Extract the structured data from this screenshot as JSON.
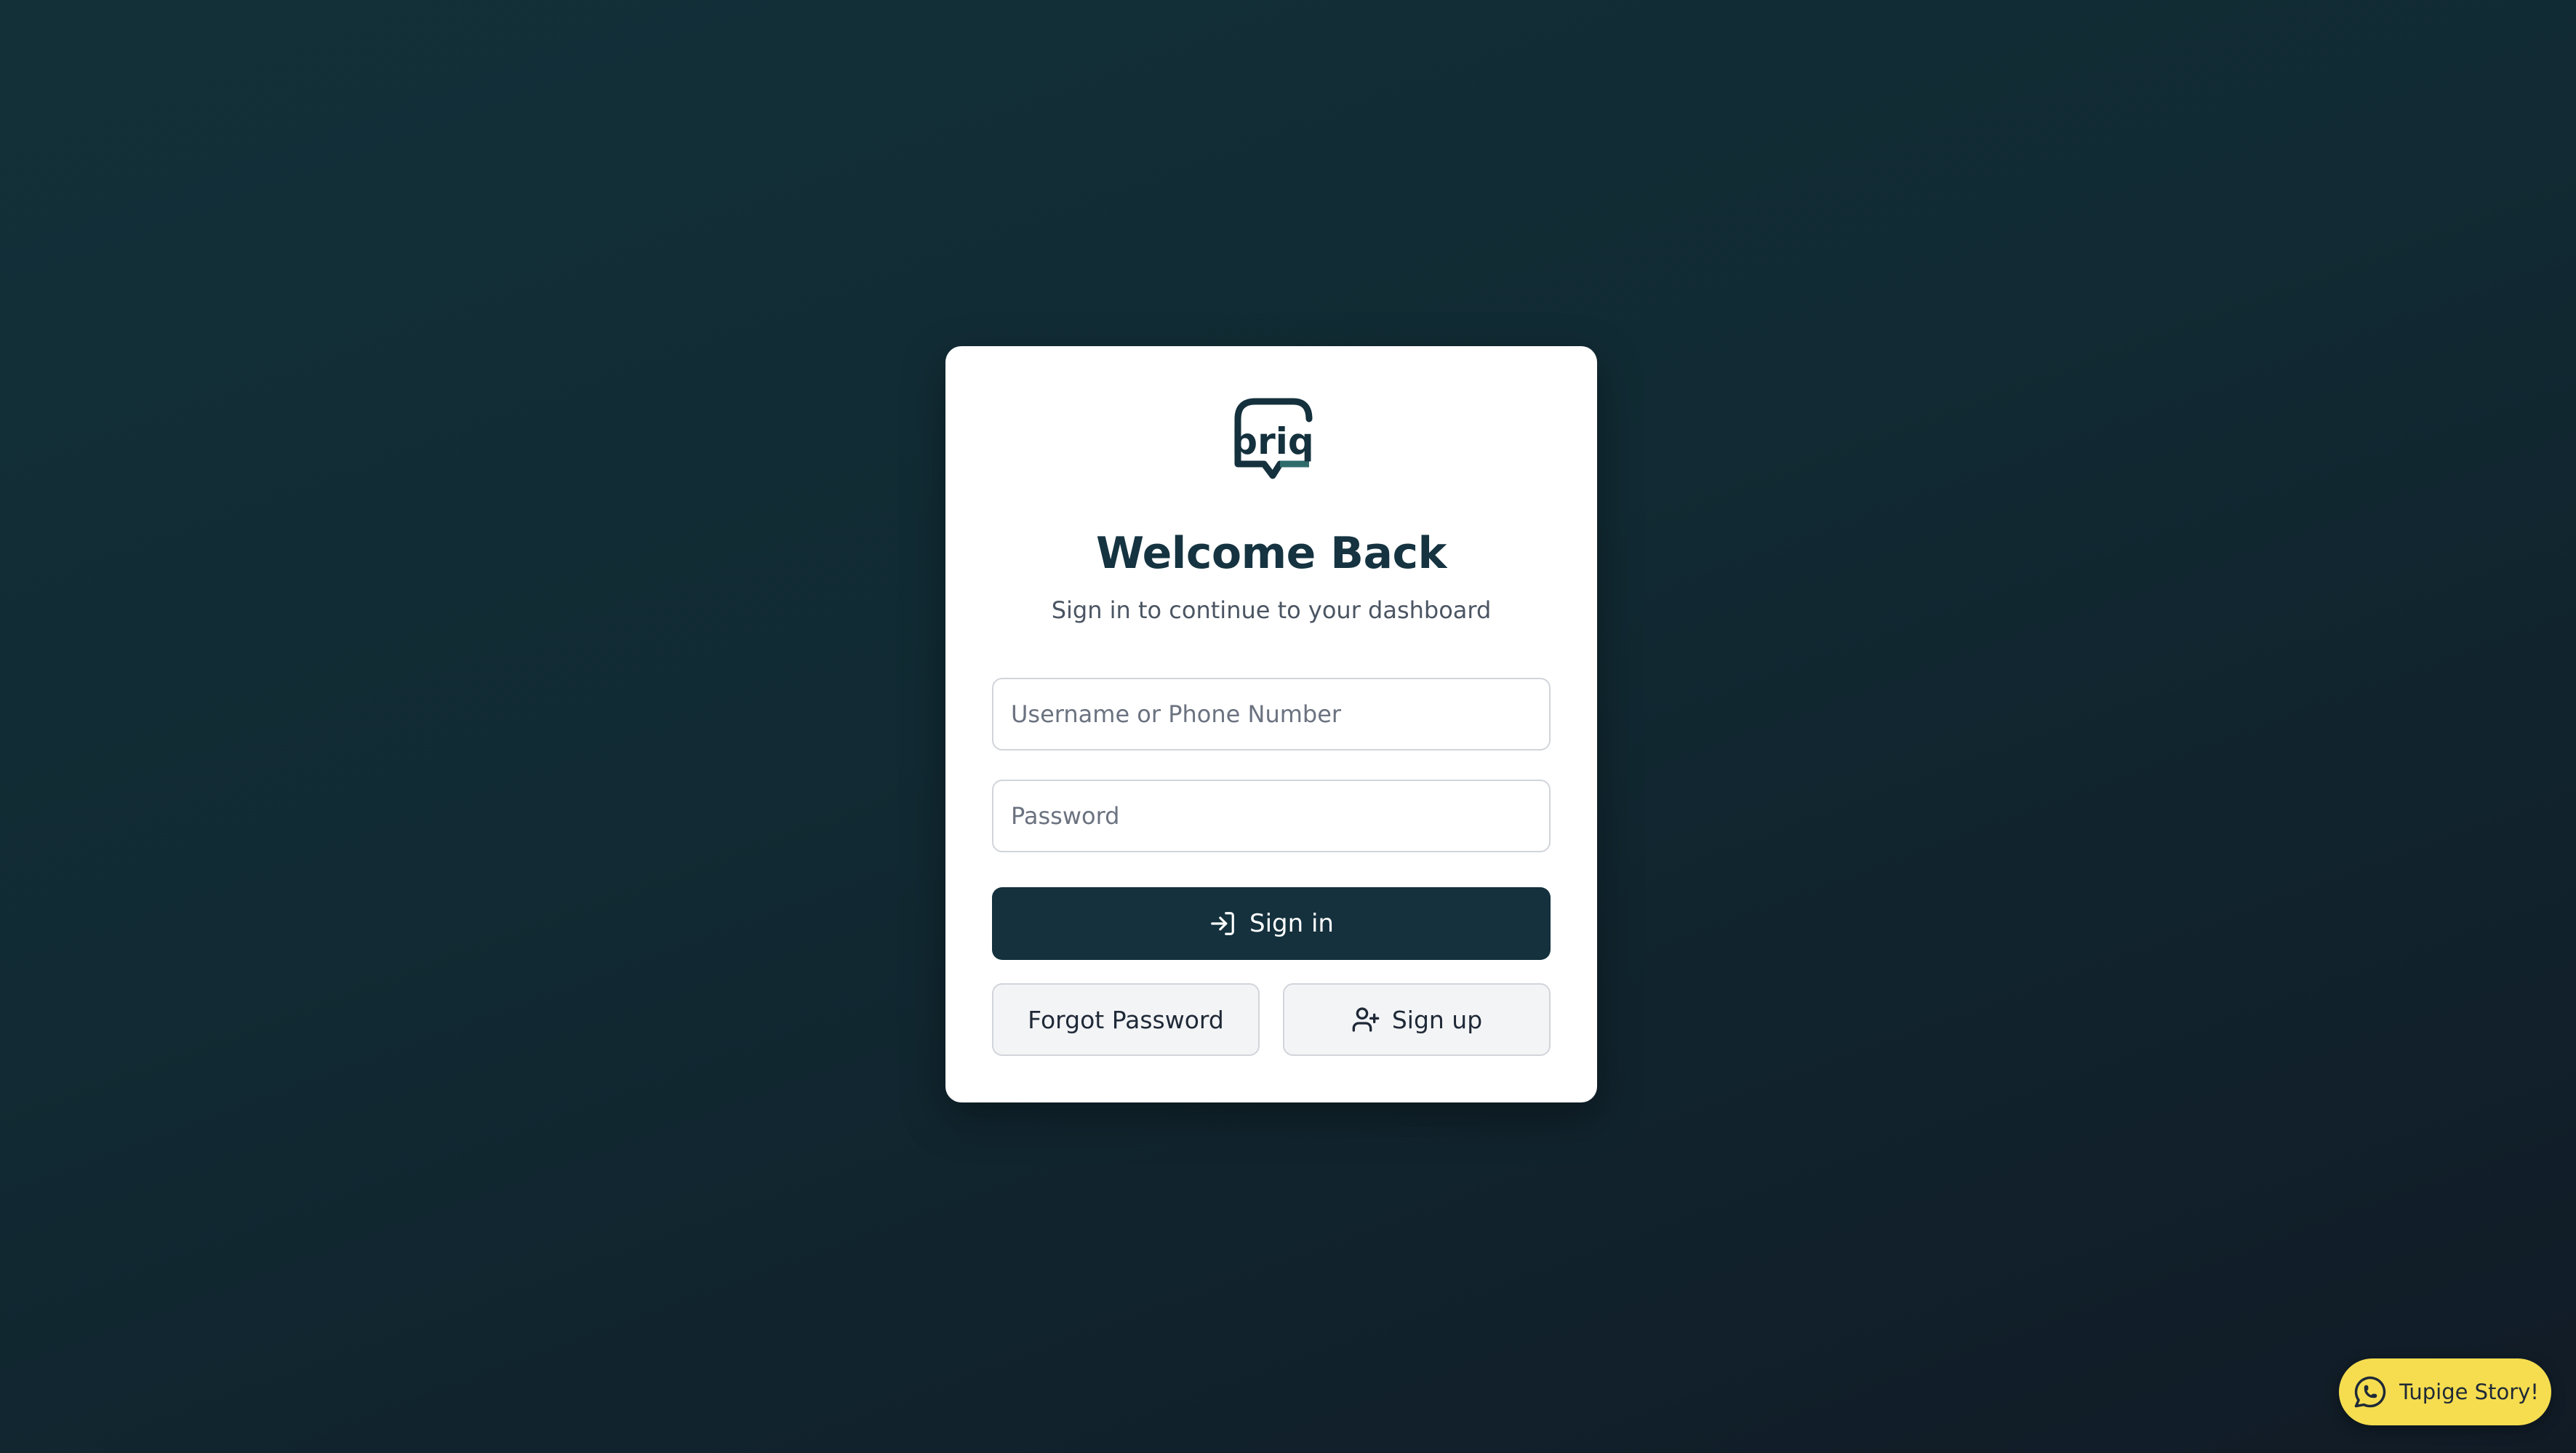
{
  "brand": {
    "logo_text": "briq",
    "logo_icon": "briq-speech-bubble-logo"
  },
  "login": {
    "title": "Welcome Back",
    "subtitle": "Sign in to continue to your dashboard",
    "username_placeholder": "Username or Phone Number",
    "username_value": "",
    "password_placeholder": "Password",
    "password_value": "",
    "sign_in_label": "Sign in",
    "sign_in_icon": "log-in-icon",
    "forgot_password_label": "Forgot Password",
    "sign_up_label": "Sign up",
    "sign_up_icon": "user-plus-icon"
  },
  "whatsapp_widget": {
    "label": "Tupige Story!",
    "icon": "whatsapp-icon"
  },
  "colors": {
    "background_start": "#133039",
    "background_end": "#111b26",
    "primary": "#14313d",
    "card": "#ffffff",
    "widget": "#f5dd4f"
  }
}
